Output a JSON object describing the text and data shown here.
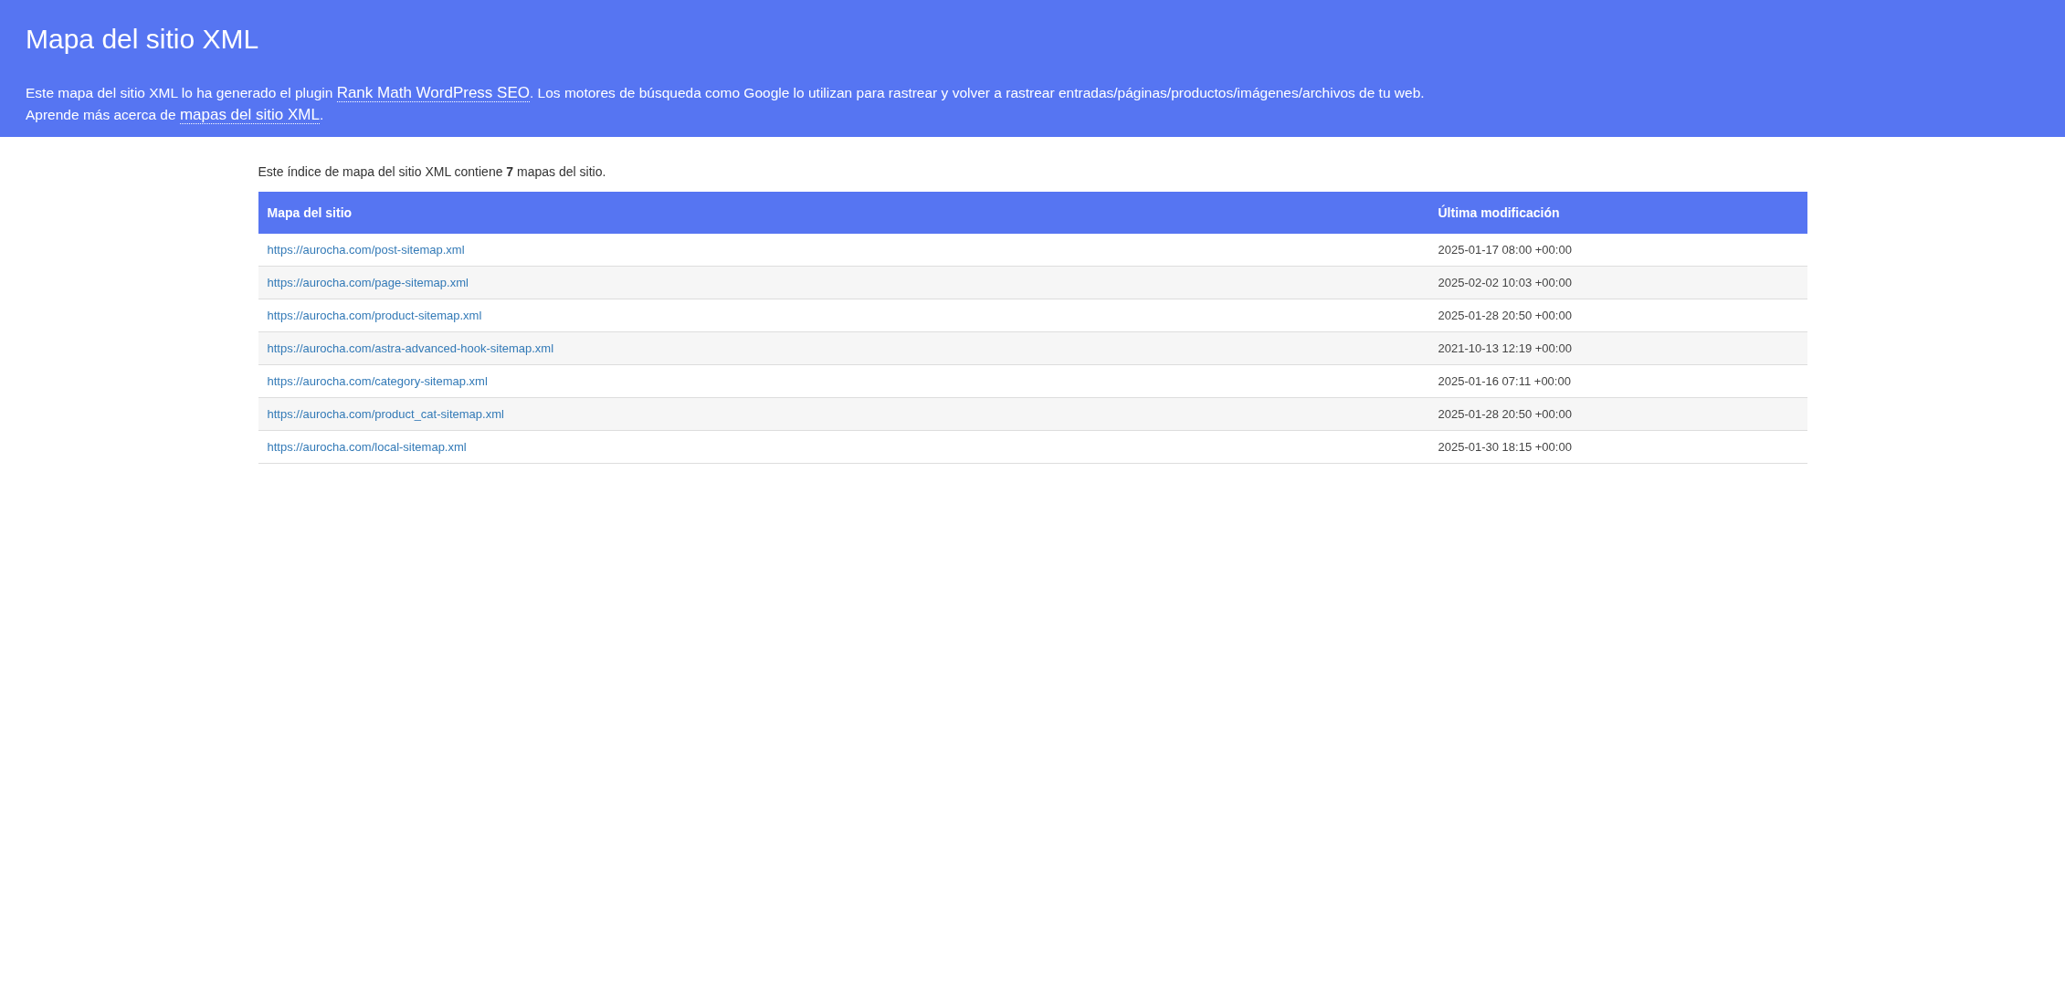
{
  "header": {
    "title": "Mapa del sitio XML",
    "description": {
      "before": "Este mapa del sitio XML lo ha generado el plugin ",
      "link": "Rank Math WordPress SEO",
      "after": ". Los motores de búsqueda como Google lo utilizan para rastrear y volver a rastrear entradas/páginas/productos/imágenes/archivos de tu web."
    },
    "learn_more": {
      "before": "Aprende más acerca de ",
      "link": "mapas del sitio XML",
      "after": "."
    }
  },
  "summary": "Este índice de mapa del sitio XML contiene **7** mapas del sitio.",
  "table": {
    "columns": [
      "Mapa del sitio",
      "Última modificación"
    ],
    "rows": [
      {
        "url": "https://aurocha.com/post-sitemap.xml",
        "modified": "2025-01-17 08:00 +00:00"
      },
      {
        "url": "https://aurocha.com/page-sitemap.xml",
        "modified": "2025-02-02 10:03 +00:00"
      },
      {
        "url": "https://aurocha.com/product-sitemap.xml",
        "modified": "2025-01-28 20:50 +00:00"
      },
      {
        "url": "https://aurocha.com/astra-advanced-hook-sitemap.xml",
        "modified": "2021-10-13 12:19 +00:00"
      },
      {
        "url": "https://aurocha.com/category-sitemap.xml",
        "modified": "2025-01-16 07:11 +00:00"
      },
      {
        "url": "https://aurocha.com/product_cat-sitemap.xml",
        "modified": "2025-01-28 20:50 +00:00"
      },
      {
        "url": "https://aurocha.com/local-sitemap.xml",
        "modified": "2025-01-30 18:15 +00:00"
      }
    ]
  }
}
